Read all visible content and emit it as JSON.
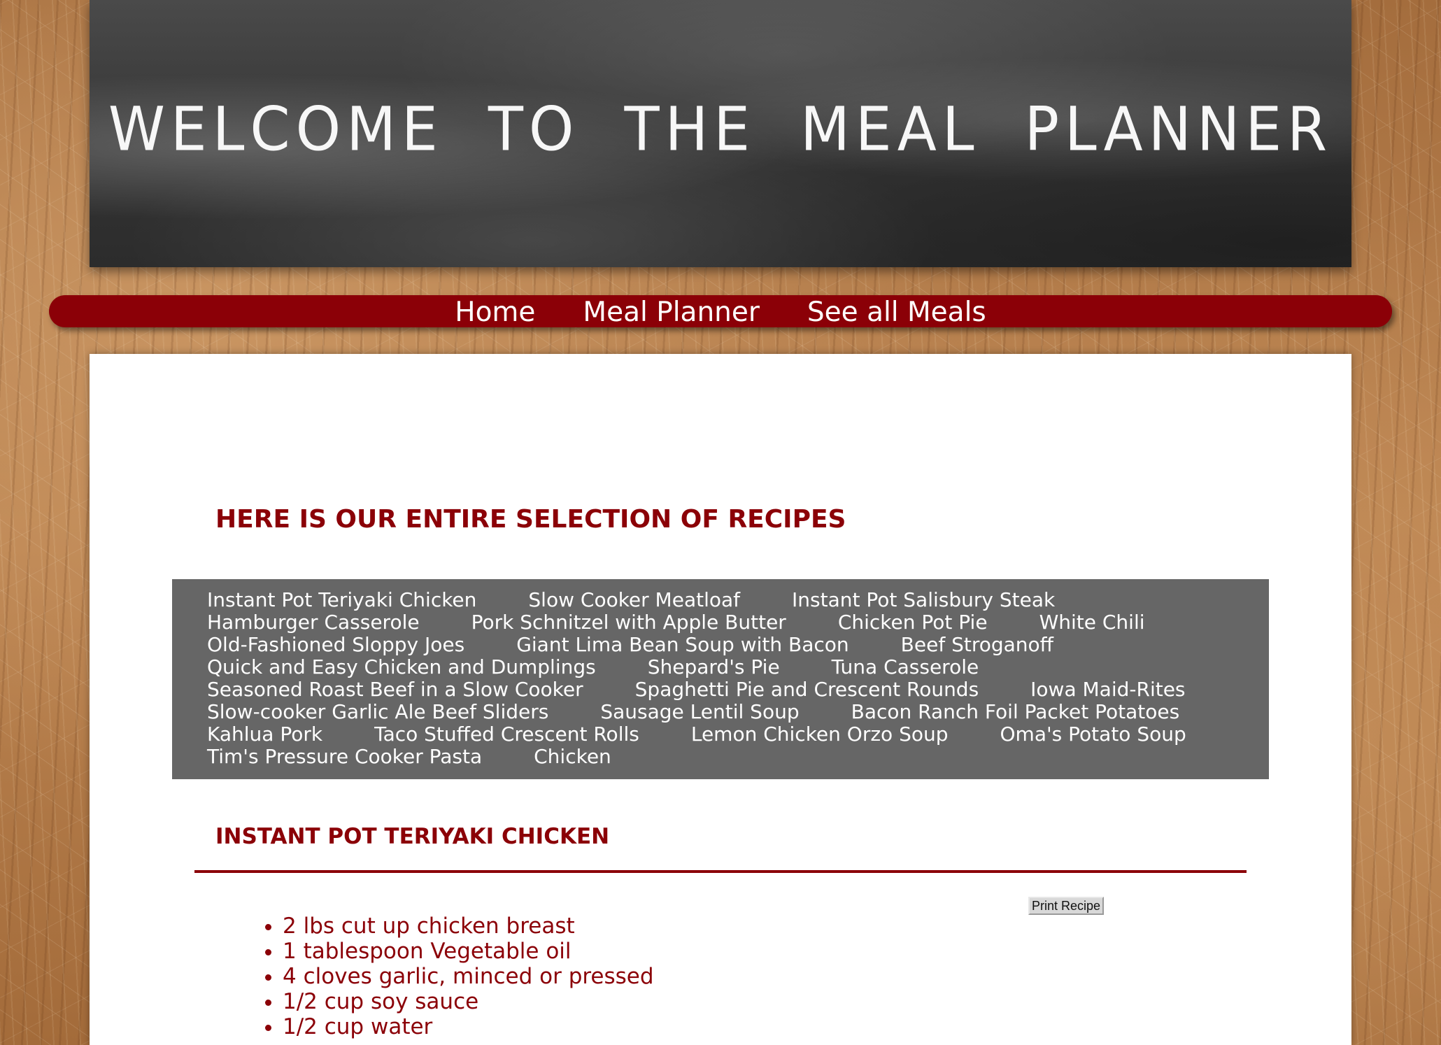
{
  "header": {
    "title": "WELCOME TO THE MEAL PLANNER"
  },
  "nav": {
    "items": [
      {
        "label": "Home"
      },
      {
        "label": "Meal Planner"
      },
      {
        "label": "See all Meals"
      }
    ]
  },
  "main": {
    "section_heading": "HERE IS OUR ENTIRE SELECTION OF RECIPES",
    "recipe_rows": [
      [
        "Instant Pot Teriyaki Chicken",
        "Slow Cooker Meatloaf",
        "Instant Pot Salisbury Steak"
      ],
      [
        "Hamburger Casserole",
        "Pork Schnitzel with Apple Butter",
        "Chicken Pot Pie",
        "White Chili"
      ],
      [
        "Old-Fashioned Sloppy Joes",
        "Giant Lima Bean Soup with Bacon",
        "Beef Stroganoff"
      ],
      [
        "Quick and Easy Chicken and Dumplings",
        "Shepard's Pie",
        "Tuna Casserole"
      ],
      [
        "Seasoned Roast Beef in a Slow Cooker",
        "Spaghetti Pie and Crescent Rounds",
        "Iowa Maid-Rites"
      ],
      [
        "Slow-cooker Garlic Ale Beef Sliders",
        "Sausage Lentil Soup",
        "Bacon Ranch Foil Packet Potatoes"
      ],
      [
        "Kahlua Pork",
        "Taco Stuffed Crescent Rolls",
        "Lemon Chicken Orzo Soup",
        "Oma's Potato Soup"
      ],
      [
        "Tim's Pressure Cooker Pasta",
        "Chicken"
      ]
    ],
    "selected_recipe": {
      "title": "INSTANT POT TERIYAKI CHICKEN",
      "print_label": "Print Recipe",
      "ingredients": [
        "2 lbs cut up chicken breast",
        "1 tablespoon Vegetable oil",
        "4 cloves garlic, minced or pressed",
        "1/2 cup soy sauce",
        "1/2 cup water"
      ]
    }
  },
  "colors": {
    "accent": "#8b0007",
    "recipe_box": "#666666",
    "chalkboard": "#3c3c3c"
  }
}
